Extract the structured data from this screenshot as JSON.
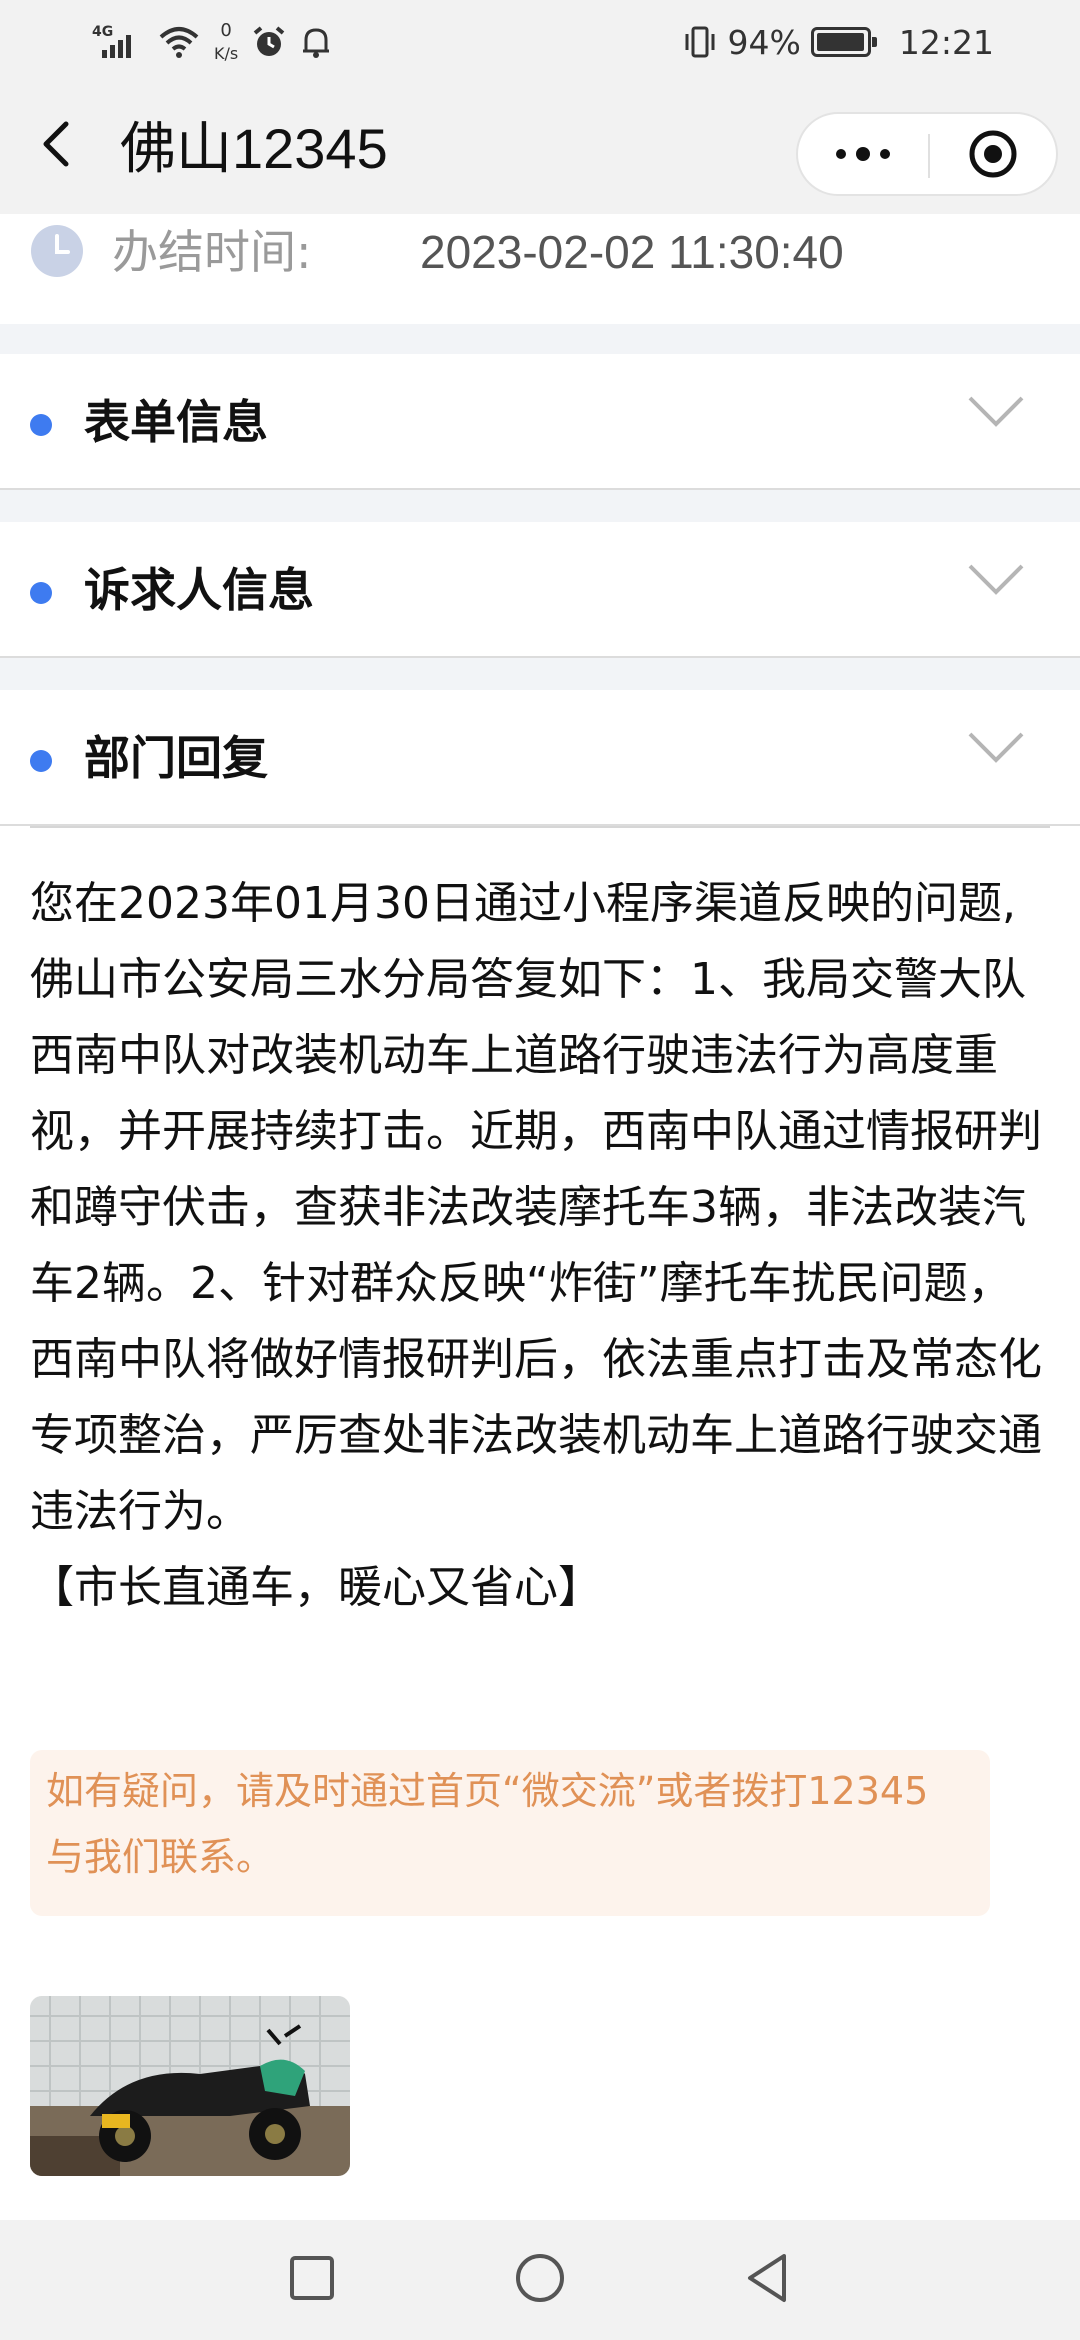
{
  "status_bar": {
    "network": "4G",
    "net_speed_value": "0",
    "net_speed_unit": "K/s",
    "battery": "94%",
    "time": "12:21"
  },
  "nav": {
    "title": "佛山12345"
  },
  "completion": {
    "label": "办结时间:",
    "value": "2023-02-02 11:30:40"
  },
  "sections": [
    {
      "title": "表单信息"
    },
    {
      "title": "诉求人信息"
    },
    {
      "title": "部门回复"
    }
  ],
  "reply": {
    "text": "您在2023年01月30日通过小程序渠道反映的问题,\n佛山市公安局三水分局答复如下：1、我局交警大队西南中队对改装机动车上道路行驶违法行为高度重视，并开展持续打击。近期，西南中队通过情报研判和蹲守伏击，查获非法改装摩托车3辆，非法改装汽车2辆。2、针对群众反映“炸街”摩托车扰民问题，西南中队将做好情报研判后，依法重点打击及常态化专项整治，严厉查处非法改装机动车上道路行驶交通违法行为。\n【市长直通车，暖心又省心】",
    "notice": "如有疑问，请及时通过首页“微交流”或者拨打12345与我们联系。"
  },
  "colors": {
    "accent_dot": "#3e7bf0",
    "notice_text": "#e09156",
    "notice_bg": "#fdf3ec"
  }
}
